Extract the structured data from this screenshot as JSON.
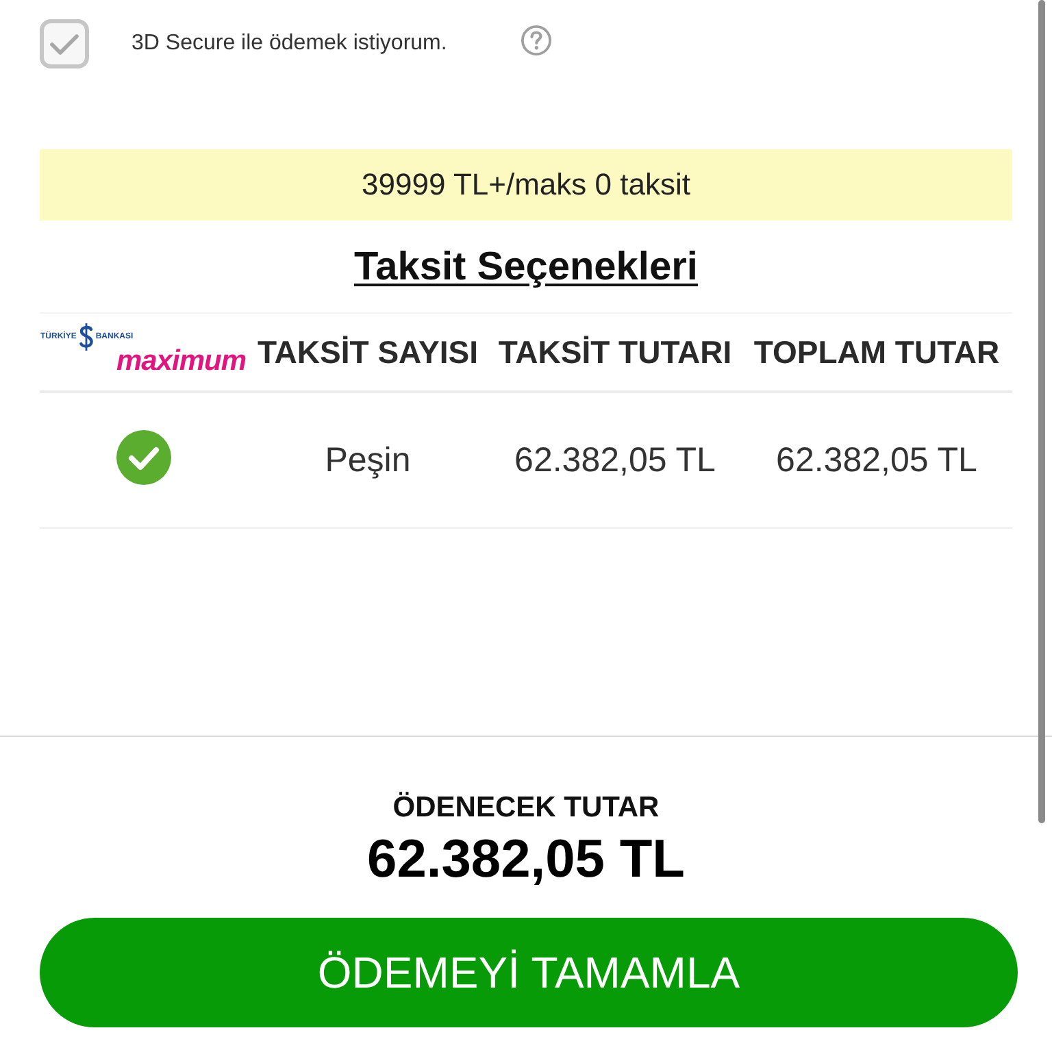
{
  "secure_option": {
    "label": "3D Secure ile ödemek istiyorum.",
    "checked": true
  },
  "installment_banner": {
    "text": "39999 TL+/maks 0 taksit"
  },
  "installments": {
    "title": "Taksit Seçenekleri",
    "bank_logo": {
      "top_left": "TÜRKİYE",
      "top_right": "BANKASI",
      "brand": "maximum"
    },
    "columns": [
      "TAKSİT SAYISI",
      "TAKSİT TUTARI",
      "TOPLAM TUTAR"
    ],
    "rows": [
      {
        "selected": true,
        "count": "Peşin",
        "installment_amount": "62.382,05 TL",
        "total_amount": "62.382,05 TL"
      }
    ]
  },
  "summary": {
    "label": "ÖDENECEK TUTAR",
    "amount": "62.382,05 TL"
  },
  "button": "ÖDEMEYİ TAMAMLA"
}
